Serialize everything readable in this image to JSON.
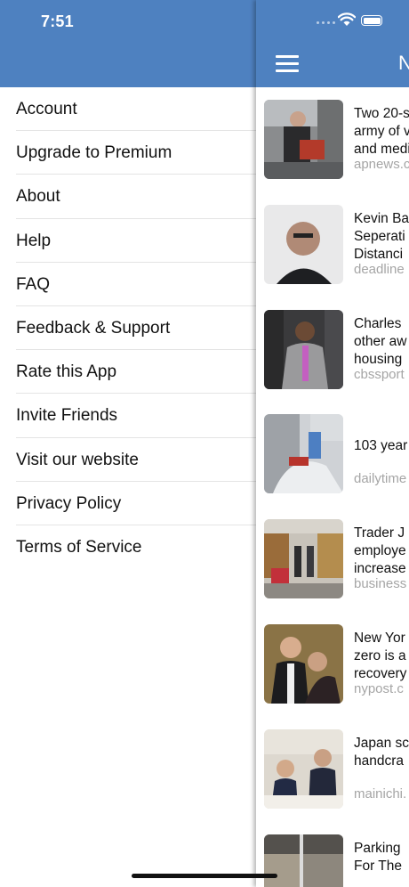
{
  "status_bar": {
    "time": "7:51"
  },
  "drawer": {
    "menu_items": [
      "Account",
      "Upgrade to Premium",
      "About",
      "Help",
      "FAQ",
      "Feedback & Support",
      "Rate this App",
      "Invite Friends",
      "Visit our website",
      "Privacy Policy",
      "Terms of Service"
    ]
  },
  "main": {
    "header_title": "N",
    "icons": {
      "menu": "hamburger-icon",
      "wifi": "wifi-icon",
      "battery": "battery-icon"
    },
    "articles": [
      {
        "headline": "Two 20-s\narmy of v\nand medi",
        "source": "apnews.c"
      },
      {
        "headline": "Kevin Ba\nSeperati\nDistanci",
        "source": "deadline"
      },
      {
        "headline": "Charles\nother aw\nhousing",
        "source": "cbssport"
      },
      {
        "headline": "\n103 year",
        "source": "dailytime"
      },
      {
        "headline": "Trader J\nemploye\nincrease",
        "source": "business"
      },
      {
        "headline": "New Yor\nzero is a\nrecovery",
        "source": "nypost.c"
      },
      {
        "headline": "Japan sc\nhandcra",
        "source": "mainichi."
      },
      {
        "headline": "Parking\nFor The",
        "source": ""
      }
    ]
  },
  "colors": {
    "header": "#4e81c0",
    "source_text": "#a5a5a5"
  }
}
